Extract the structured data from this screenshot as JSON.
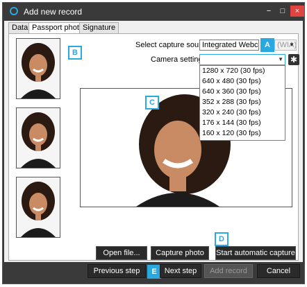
{
  "window": {
    "title": "Add new record",
    "min_glyph": "−",
    "max_glyph": "□",
    "close_glyph": "×"
  },
  "tabs": [
    {
      "label": "Data",
      "active": false
    },
    {
      "label": "Passport photo",
      "active": true
    },
    {
      "label": "Signature",
      "active": false
    }
  ],
  "capture": {
    "source_label": "Select capture source:",
    "source_value": "Integrated Webcam",
    "source_suffix": "(WIA)",
    "camera_settings_label": "Camera settings:",
    "camera_settings_value": "",
    "settings_glyph": "✱"
  },
  "resolution_options": [
    "1280 x 720 (30 fps)",
    "640 x 480 (30 fps)",
    "640 x 360 (30 fps)",
    "352 x 288 (30 fps)",
    "320 x 240 (30 fps)",
    "176 x 144 (30 fps)",
    "160 x 120 (30 fps)"
  ],
  "callouts": {
    "a": "A",
    "b": "B",
    "c": "C",
    "d": "D",
    "e": "E"
  },
  "actions": {
    "open_file": "Open file...",
    "capture_photo": "Capture photo",
    "start_auto": "Start automatic capture"
  },
  "footer": {
    "previous": "Previous step",
    "next": "Next step",
    "add_record": "Add record",
    "cancel": "Cancel"
  },
  "colors": {
    "accent": "#2aa8e0",
    "titlebar": "#3a3a3a",
    "close": "#e0443e"
  }
}
